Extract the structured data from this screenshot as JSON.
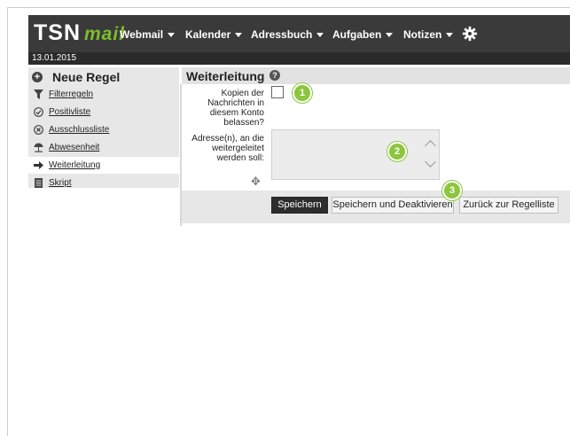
{
  "app": {
    "logo_main": "TSN",
    "logo_sub": "mail",
    "date": "13.01.2015"
  },
  "nav": [
    {
      "label": "Webmail"
    },
    {
      "label": "Kalender"
    },
    {
      "label": "Adressbuch"
    },
    {
      "label": "Aufgaben"
    },
    {
      "label": "Notizen"
    }
  ],
  "sidebar": {
    "title": "Neue Regel",
    "items": [
      {
        "label": "Filterregeln",
        "icon": "filter-icon"
      },
      {
        "label": "Positivliste",
        "icon": "check-circle-icon"
      },
      {
        "label": "Ausschlussliste",
        "icon": "x-circle-icon"
      },
      {
        "label": "Abwesenheit",
        "icon": "beach-umbrella-icon"
      },
      {
        "label": "Weiterleitung",
        "icon": "arrow-right-icon",
        "active": true
      },
      {
        "label": "Skript",
        "icon": "document-icon"
      }
    ]
  },
  "main": {
    "title": "Weiterleitung",
    "copy_label": "Kopien der Nachrichten in diesem Konto belassen?",
    "copy_label_lines": [
      "Kopien der",
      "Nachrichten in",
      "diesem Konto",
      "belassen?"
    ],
    "address_label_lines": [
      "Adresse(n), an die",
      "weitergeleitet",
      "werden soll:"
    ],
    "address_value": "",
    "badges": [
      "1",
      "2",
      "3"
    ]
  },
  "buttons": {
    "save": "Speichern",
    "save_deactivate": "Speichern und Deaktivieren",
    "back": "Zurück zur Regelliste"
  },
  "colors": {
    "accent_green": "#8cc63f",
    "topbar": "#3a3a3a"
  }
}
